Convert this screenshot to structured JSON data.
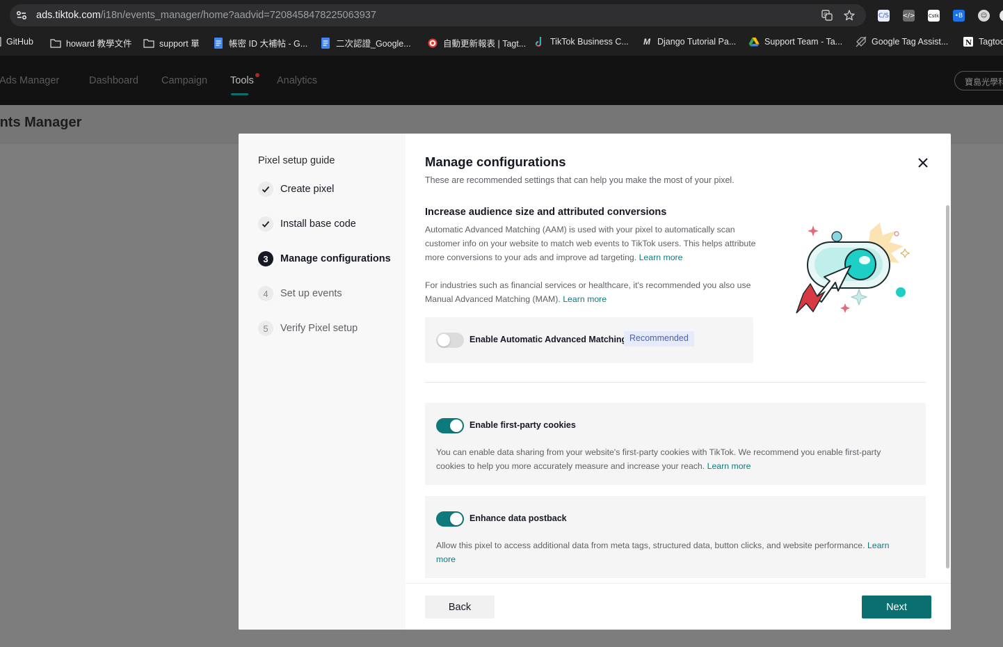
{
  "browser": {
    "url_host": "ads.tiktok.com",
    "url_path": "/i18n/events_manager/home?aadvid=7208458478225063937",
    "bookmarks": [
      {
        "label": "GitHub",
        "icon": "github-icon"
      },
      {
        "label": "howard 教學文件",
        "icon": "folder-icon"
      },
      {
        "label": "support 單",
        "icon": "folder-icon"
      },
      {
        "label": "帳密 ID 大補帖 - G...",
        "icon": "docs-icon"
      },
      {
        "label": "二次認證_Google...",
        "icon": "docs-icon"
      },
      {
        "label": "自動更新報表 | Tagt...",
        "icon": "target-icon"
      },
      {
        "label": "TikTok Business C...",
        "icon": "tiktok-icon"
      },
      {
        "label": "Django Tutorial Pa...",
        "icon": "m-icon"
      },
      {
        "label": "Support Team - Ta...",
        "icon": "drive-icon"
      },
      {
        "label": "Google Tag Assist...",
        "icon": "tag-icon"
      },
      {
        "label": "Tagtoo",
        "icon": "notion-icon"
      }
    ]
  },
  "app_nav": {
    "brand": "Ads Manager",
    "items": [
      "Dashboard",
      "Campaign",
      "Tools",
      "Analytics"
    ],
    "active": "Tools",
    "account": "寶島光學科技"
  },
  "page": {
    "title": "Events Manager"
  },
  "modal": {
    "side_title": "Pixel setup guide",
    "steps": [
      {
        "num": "1",
        "label": "Create pixel",
        "state": "done"
      },
      {
        "num": "2",
        "label": "Install base code",
        "state": "done"
      },
      {
        "num": "3",
        "label": "Manage configurations",
        "state": "current"
      },
      {
        "num": "4",
        "label": "Set up events",
        "state": "todo"
      },
      {
        "num": "5",
        "label": "Verify Pixel setup",
        "state": "todo"
      }
    ],
    "title": "Manage configurations",
    "subtitle": "These are recommended settings that can help you make the most of your pixel.",
    "section_title": "Increase audience size and attributed conversions",
    "aam_desc": "Automatic Advanced Matching (AAM) is used with your pixel to automatically scan customer info on your website to match web events to TikTok users. This helps attribute more conversions to your ads and improve ad targeting.",
    "mam_desc": "For industries such as financial services or healthcare, it's recommended you also use Manual Advanced Matching (MAM).",
    "learn_more": "Learn more",
    "aam_toggle": {
      "label": "Enable Automatic Advanced Matching",
      "tag": "Recommended",
      "on": false
    },
    "cookies": {
      "label": "Enable first-party cookies",
      "on": true,
      "desc": "You can enable data sharing from your website's first-party cookies with TikTok. We recommend you enable first-party cookies to help you more accurately measure and increase your reach."
    },
    "postback": {
      "label": "Enhance data postback",
      "on": true,
      "desc": "Allow this pixel to access additional data from meta tags, structured data, button clicks, and website performance."
    },
    "back_label": "Back",
    "next_label": "Next"
  },
  "colors": {
    "accent": "#0e7a7c",
    "button_primary": "#0b6f70",
    "tag_bg": "#e6ebfb",
    "tag_text": "#4a5fb0"
  }
}
